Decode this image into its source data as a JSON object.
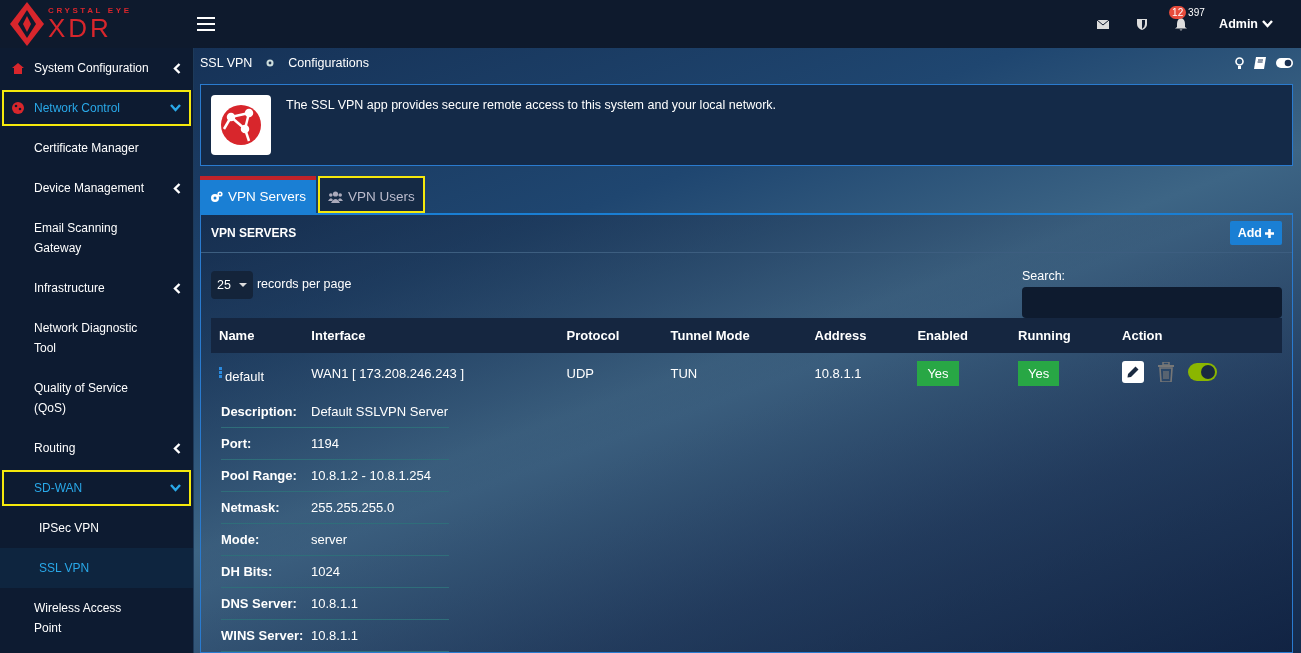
{
  "header": {
    "logo_top": "CRYSTAL EYE",
    "logo_main": "XDR",
    "notification_badge": "12",
    "notification_count": "397",
    "user": "Admin"
  },
  "sidebar": {
    "items": [
      {
        "label": "System Configuration",
        "kind": "menu",
        "expanded": false,
        "highlighted": false,
        "selected": false
      },
      {
        "label": "Network Control",
        "kind": "menu",
        "expanded": true,
        "highlighted": true,
        "selected": false,
        "children": [
          {
            "label": "Certificate Manager",
            "kind": "link",
            "highlighted": false,
            "selected": false
          },
          {
            "label": "Device Management",
            "kind": "menu",
            "expanded": false,
            "highlighted": false,
            "selected": false
          },
          {
            "label": "Email Scanning Gateway",
            "kind": "link",
            "highlighted": false,
            "selected": false
          },
          {
            "label": "Infrastructure",
            "kind": "menu",
            "expanded": false,
            "highlighted": false,
            "selected": false
          },
          {
            "label": "Network Diagnostic Tool",
            "kind": "link",
            "highlighted": false,
            "selected": false
          },
          {
            "label": "Quality of Service (QoS)",
            "kind": "link",
            "highlighted": false,
            "selected": false
          },
          {
            "label": "Routing",
            "kind": "menu",
            "expanded": false,
            "highlighted": false,
            "selected": false
          },
          {
            "label": "SD-WAN",
            "kind": "menu",
            "expanded": true,
            "highlighted": true,
            "selected": false,
            "children": [
              {
                "label": "IPSec VPN",
                "kind": "link",
                "highlighted": false,
                "selected": false
              },
              {
                "label": "SSL VPN",
                "kind": "link",
                "highlighted": false,
                "selected": true
              }
            ]
          },
          {
            "label": "Wireless Access Point",
            "kind": "link",
            "highlighted": false,
            "selected": false
          }
        ]
      }
    ]
  },
  "breadcrumb": [
    "SSL VPN",
    "Configurations"
  ],
  "intro": "The SSL VPN app provides secure remote access to this system and your local network.",
  "tabs": [
    {
      "label": "VPN Servers",
      "selected": true,
      "highlighted": false
    },
    {
      "label": "VPN Users",
      "selected": false,
      "highlighted": true
    }
  ],
  "panel": {
    "title": "VPN SERVERS",
    "add_button": "Add",
    "page_length": "25",
    "page_length_label": "records per page",
    "search_label": "Search:"
  },
  "table": {
    "columns": [
      "Name",
      "Interface",
      "Protocol",
      "Tunnel Mode",
      "Address",
      "Enabled",
      "Running",
      "Action"
    ],
    "rows": [
      {
        "name": "default",
        "interface": "WAN1 [ 173.208.246.243 ]",
        "protocol": "UDP",
        "tunnel_mode": "TUN",
        "address": "10.8.1.1",
        "enabled": "Yes",
        "running": "Yes",
        "on": true,
        "details": [
          {
            "label": "Description:",
            "value": "Default SSLVPN Server"
          },
          {
            "label": "Port:",
            "value": "1194"
          },
          {
            "label": "Pool Range:",
            "value": "10.8.1.2 - 10.8.1.254"
          },
          {
            "label": "Netmask:",
            "value": "255.255.255.0"
          },
          {
            "label": "Mode:",
            "value": "server"
          },
          {
            "label": "DH Bits:",
            "value": "1024"
          },
          {
            "label": "DNS Server:",
            "value": "10.8.1.1"
          },
          {
            "label": "WINS Server:",
            "value": "10.8.1.1"
          }
        ]
      }
    ]
  }
}
